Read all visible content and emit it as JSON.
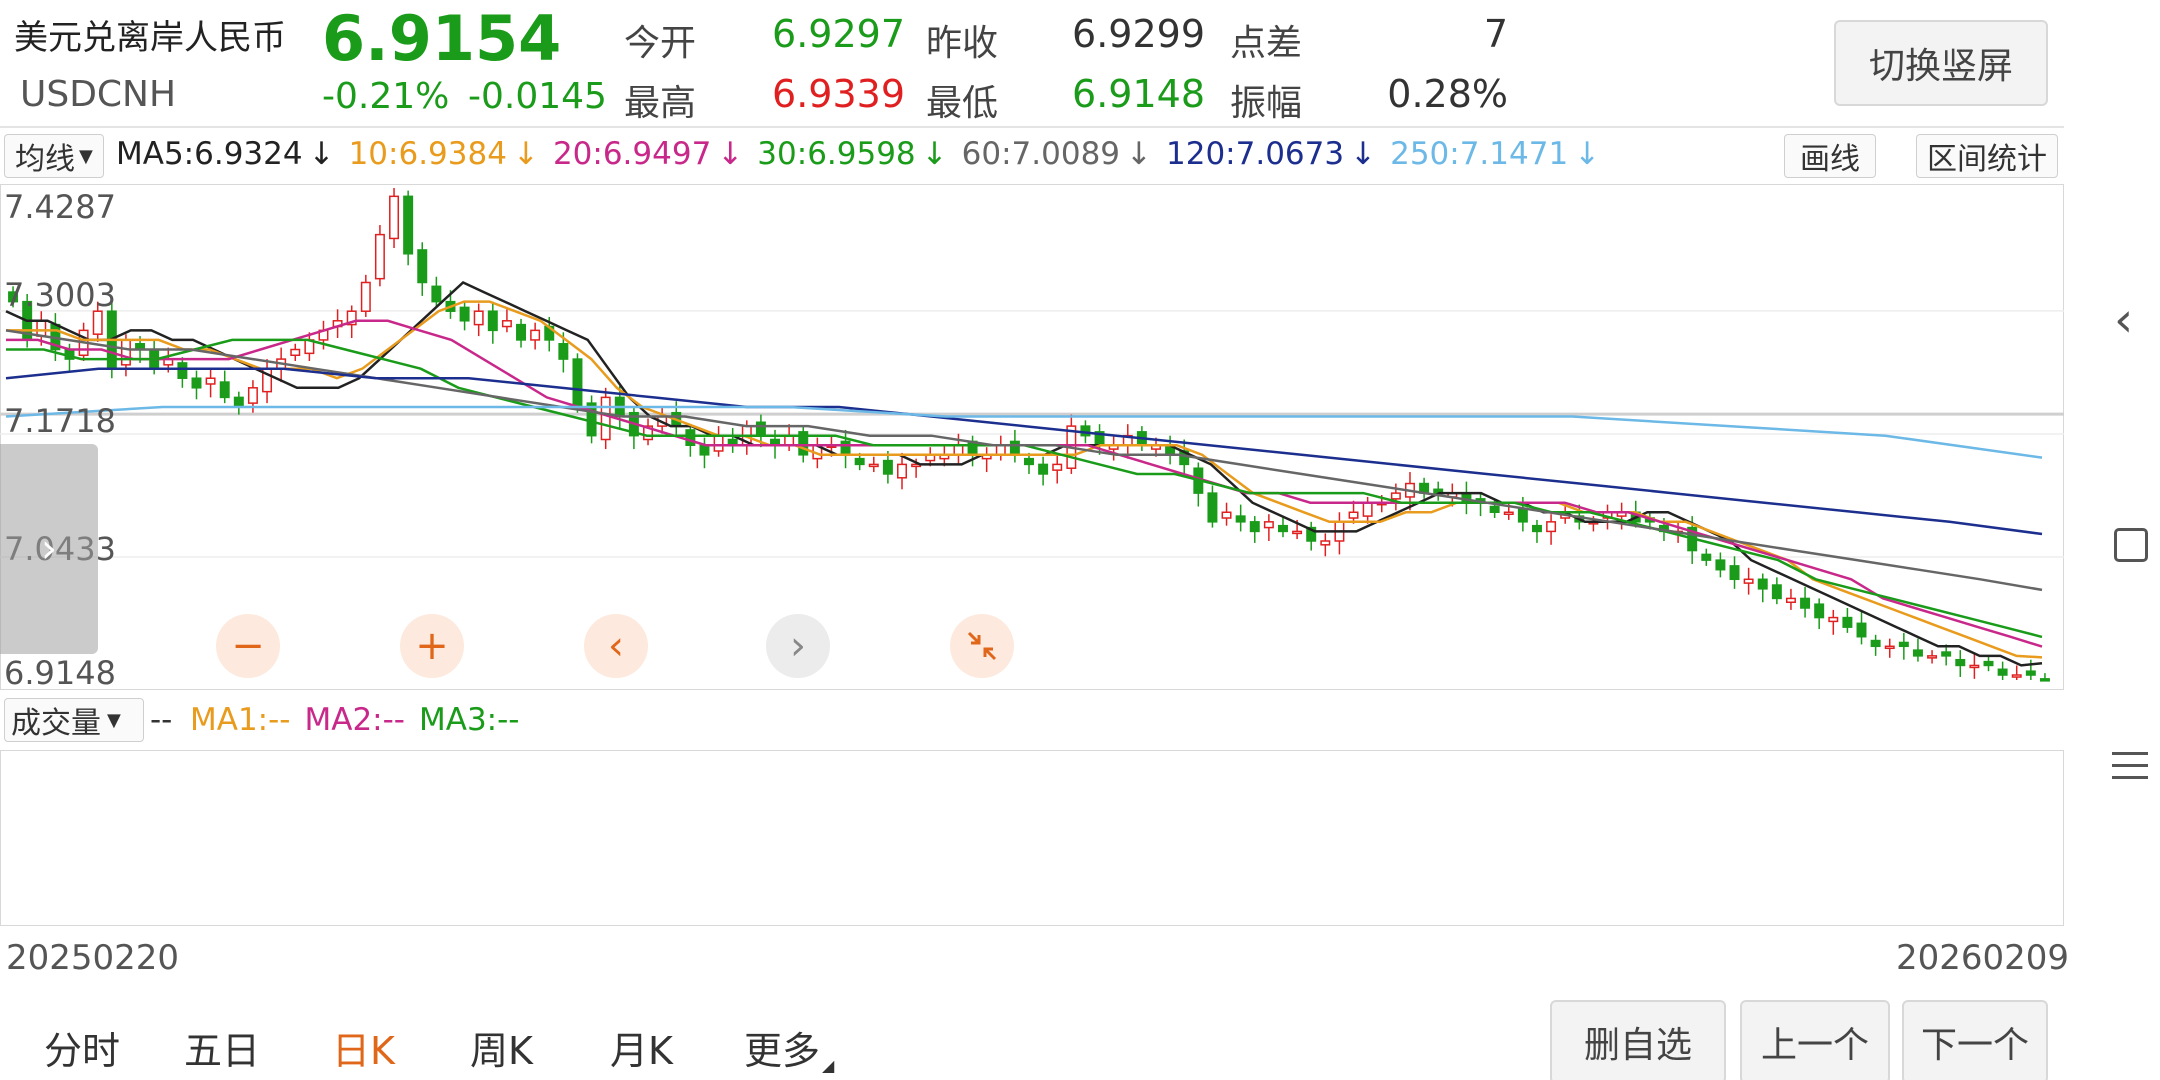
{
  "quote": {
    "name": "美元兑离岸人民币",
    "code": "USDCNH",
    "price": "6.9154",
    "change_pct": "-0.21%",
    "change_abs": "-0.0145",
    "open_label": "今开",
    "open_value": "6.9297",
    "prevclose_label": "昨收",
    "prevclose_value": "6.9299",
    "spread_label": "点差",
    "spread_value": "7",
    "high_label": "最高",
    "high_value": "6.9339",
    "low_label": "最低",
    "low_value": "6.9148",
    "amplitude_label": "振幅",
    "amplitude_value": "0.28%",
    "switch_button": "切换竖屏"
  },
  "ma_bar": {
    "dropdown_label": "均线",
    "items": [
      {
        "text": "MA5:6.9324",
        "color": "#222222"
      },
      {
        "text": "10:6.9384",
        "color": "#e89b1c"
      },
      {
        "text": "20:6.9497",
        "color": "#c8288a"
      },
      {
        "text": "30:6.9598",
        "color": "#1a9b1a"
      },
      {
        "text": "60:7.0089",
        "color": "#666666"
      },
      {
        "text": "120:7.0673",
        "color": "#1c2f8f"
      },
      {
        "text": "250:7.1471",
        "color": "#6cb8e6"
      }
    ],
    "arrow": "↓",
    "draw_button": "画线",
    "range_button": "区间统计"
  },
  "price_axis": {
    "labels": [
      "7.4287",
      "7.3003",
      "7.1718",
      "7.0433",
      "6.9148"
    ]
  },
  "volume_bar": {
    "dropdown_label": "成交量",
    "dash": "--",
    "items": [
      {
        "text": "MA1:--",
        "color": "#e89b1c"
      },
      {
        "text": "MA2:--",
        "color": "#c8288a"
      },
      {
        "text": "MA3:--",
        "color": "#1a9b1a"
      }
    ]
  },
  "date_axis": {
    "start": "20250220",
    "end": "20260209"
  },
  "tabs": [
    {
      "label": "分时",
      "active": false
    },
    {
      "label": "五日",
      "active": false
    },
    {
      "label": "日K",
      "active": true
    },
    {
      "label": "周K",
      "active": false
    },
    {
      "label": "月K",
      "active": false
    },
    {
      "label": "更多",
      "active": false
    }
  ],
  "bottom_buttons": {
    "remove_watch": "删自选",
    "prev": "上一个",
    "next": "下一个"
  },
  "colors": {
    "up": "#e02020",
    "down": "#1a9b1a",
    "accent": "#e0661a"
  },
  "chart_data": {
    "type": "candlestick",
    "start_date": "20250220",
    "end_date": "20260209",
    "ylim": [
      6.9148,
      7.4287
    ],
    "close_series": [
      7.31,
      7.27,
      7.29,
      7.26,
      7.25,
      7.28,
      7.3,
      7.24,
      7.27,
      7.26,
      7.24,
      7.25,
      7.23,
      7.22,
      7.23,
      7.21,
      7.2,
      7.22,
      7.24,
      7.25,
      7.26,
      7.27,
      7.28,
      7.29,
      7.3,
      7.33,
      7.38,
      7.42,
      7.36,
      7.33,
      7.31,
      7.3,
      7.29,
      7.3,
      7.28,
      7.29,
      7.27,
      7.28,
      7.27,
      7.25,
      7.2,
      7.17,
      7.21,
      7.19,
      7.17,
      7.18,
      7.19,
      7.18,
      7.16,
      7.15,
      7.17,
      7.16,
      7.18,
      7.17,
      7.16,
      7.17,
      7.15,
      7.16,
      7.16,
      7.15,
      7.14,
      7.14,
      7.13,
      7.14,
      7.14,
      7.15,
      7.15,
      7.16,
      7.15,
      7.15,
      7.16,
      7.15,
      7.14,
      7.13,
      7.14,
      7.18,
      7.17,
      7.16,
      7.16,
      7.17,
      7.16,
      7.16,
      7.15,
      7.14,
      7.11,
      7.08,
      7.09,
      7.08,
      7.07,
      7.08,
      7.07,
      7.07,
      7.06,
      7.06,
      7.08,
      7.09,
      7.1,
      7.1,
      7.11,
      7.12,
      7.11,
      7.11,
      7.11,
      7.1,
      7.1,
      7.09,
      7.09,
      7.08,
      7.07,
      7.08,
      7.09,
      7.08,
      7.08,
      7.09,
      7.09,
      7.08,
      7.08,
      7.07,
      7.07,
      7.05,
      7.04,
      7.03,
      7.02,
      7.02,
      7.01,
      7.0,
      7.0,
      6.99,
      6.98,
      6.98,
      6.97,
      6.96,
      6.95,
      6.95,
      6.95,
      6.94,
      6.94,
      6.94,
      6.93,
      6.93,
      6.93,
      6.92,
      6.92,
      6.92,
      6.9154
    ],
    "ma_series": {
      "MA5": [
        7.3,
        7.29,
        7.29,
        7.28,
        7.27,
        7.27,
        7.28,
        7.28,
        7.27,
        7.27,
        7.26,
        7.25,
        7.24,
        7.23,
        7.22,
        7.22,
        7.22,
        7.23,
        7.25,
        7.27,
        7.29,
        7.31,
        7.33,
        7.32,
        7.31,
        7.3,
        7.29,
        7.28,
        7.27,
        7.24,
        7.21,
        7.19,
        7.18,
        7.18,
        7.17,
        7.17,
        7.16,
        7.16,
        7.16,
        7.16,
        7.15,
        7.15,
        7.15,
        7.15,
        7.14,
        7.14,
        7.14,
        7.15,
        7.15,
        7.15,
        7.15,
        7.16,
        7.16,
        7.16,
        7.16,
        7.16,
        7.16,
        7.15,
        7.14,
        7.12,
        7.1,
        7.09,
        7.08,
        7.07,
        7.07,
        7.07,
        7.08,
        7.09,
        7.1,
        7.11,
        7.11,
        7.11,
        7.1,
        7.1,
        7.09,
        7.09,
        7.08,
        7.08,
        7.08,
        7.09,
        7.09,
        7.08,
        7.07,
        7.06,
        7.04,
        7.03,
        7.02,
        7.01,
        7.0,
        6.99,
        6.98,
        6.97,
        6.96,
        6.95,
        6.95,
        6.94,
        6.94,
        6.93,
        6.9324
      ],
      "MA10": [
        7.28,
        7.28,
        7.28,
        7.27,
        7.27,
        7.27,
        7.27,
        7.26,
        7.26,
        7.25,
        7.24,
        7.24,
        7.24,
        7.23,
        7.24,
        7.26,
        7.28,
        7.3,
        7.31,
        7.31,
        7.3,
        7.29,
        7.27,
        7.25,
        7.22,
        7.2,
        7.19,
        7.18,
        7.17,
        7.17,
        7.16,
        7.16,
        7.15,
        7.15,
        7.15,
        7.15,
        7.15,
        7.15,
        7.15,
        7.15,
        7.15,
        7.15,
        7.15,
        7.16,
        7.16,
        7.16,
        7.16,
        7.15,
        7.13,
        7.11,
        7.1,
        7.09,
        7.08,
        7.08,
        7.08,
        7.09,
        7.09,
        7.1,
        7.1,
        7.1,
        7.1,
        7.1,
        7.09,
        7.09,
        7.09,
        7.08,
        7.08,
        7.07,
        7.06,
        7.05,
        7.04,
        7.02,
        7.01,
        7.0,
        6.99,
        6.98,
        6.97,
        6.96,
        6.95,
        6.94,
        6.9384
      ],
      "MA20": [
        7.27,
        7.27,
        7.26,
        7.26,
        7.25,
        7.25,
        7.25,
        7.25,
        7.26,
        7.27,
        7.28,
        7.29,
        7.29,
        7.28,
        7.27,
        7.25,
        7.23,
        7.21,
        7.2,
        7.19,
        7.18,
        7.17,
        7.16,
        7.16,
        7.16,
        7.16,
        7.16,
        7.16,
        7.16,
        7.16,
        7.16,
        7.16,
        7.16,
        7.16,
        7.16,
        7.15,
        7.14,
        7.13,
        7.12,
        7.11,
        7.11,
        7.1,
        7.1,
        7.1,
        7.1,
        7.1,
        7.1,
        7.1,
        7.1,
        7.1,
        7.09,
        7.09,
        7.08,
        7.07,
        7.06,
        7.05,
        7.04,
        7.03,
        7.02,
        7.0,
        6.99,
        6.98,
        6.97,
        6.96,
        6.9497
      ],
      "MA30": [
        7.26,
        7.26,
        7.25,
        7.25,
        7.25,
        7.26,
        7.27,
        7.27,
        7.27,
        7.26,
        7.25,
        7.24,
        7.22,
        7.21,
        7.2,
        7.19,
        7.18,
        7.17,
        7.17,
        7.17,
        7.17,
        7.17,
        7.17,
        7.16,
        7.16,
        7.16,
        7.16,
        7.16,
        7.15,
        7.14,
        7.13,
        7.13,
        7.12,
        7.11,
        7.11,
        7.11,
        7.11,
        7.1,
        7.1,
        7.1,
        7.1,
        7.09,
        7.09,
        7.08,
        7.07,
        7.06,
        7.05,
        7.04,
        7.02,
        7.01,
        7.0,
        6.99,
        6.98,
        6.97,
        6.9598
      ],
      "MA60": [
        7.28,
        7.27,
        7.26,
        7.26,
        7.25,
        7.24,
        7.23,
        7.22,
        7.21,
        7.2,
        7.19,
        7.19,
        7.18,
        7.18,
        7.17,
        7.17,
        7.16,
        7.16,
        7.15,
        7.15,
        7.14,
        7.13,
        7.12,
        7.11,
        7.1,
        7.09,
        7.08,
        7.07,
        7.06,
        7.05,
        7.04,
        7.03,
        7.02,
        7.0089
      ],
      "MA120": [
        7.23,
        7.24,
        7.24,
        7.24,
        7.23,
        7.23,
        7.22,
        7.21,
        7.2,
        7.2,
        7.19,
        7.18,
        7.17,
        7.16,
        7.15,
        7.14,
        7.13,
        7.12,
        7.11,
        7.1,
        7.09,
        7.08,
        7.0673
      ],
      "MA250": [
        7.19,
        7.2,
        7.2,
        7.2,
        7.2,
        7.2,
        7.19,
        7.19,
        7.19,
        7.19,
        7.19,
        7.18,
        7.17,
        7.1471
      ]
    }
  }
}
